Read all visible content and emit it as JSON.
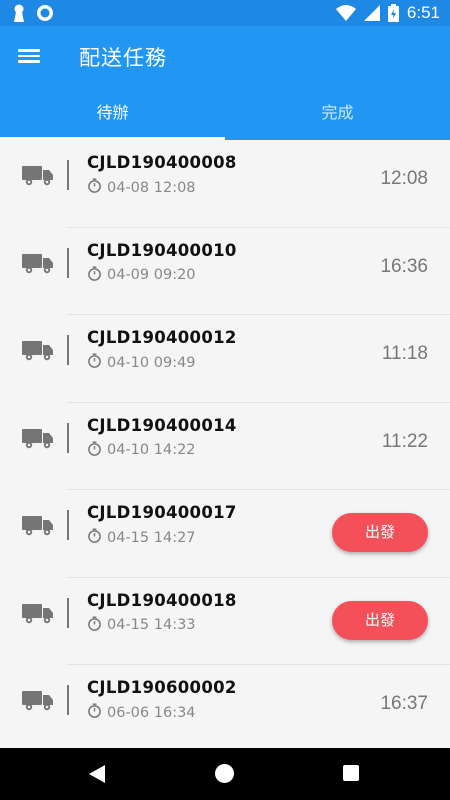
{
  "status_bar": {
    "time": "6:51",
    "icons": [
      "keyhole-icon",
      "circle-notification-icon",
      "wifi-icon",
      "cell-signal-icon",
      "battery-charging-icon"
    ]
  },
  "app_bar": {
    "title": "配送任務",
    "menu_icon": "hamburger-menu-icon"
  },
  "tabs": [
    {
      "label": "待辦",
      "active": true
    },
    {
      "label": "完成",
      "active": false
    }
  ],
  "tasks": [
    {
      "code": "CJLD190400008",
      "datetime": "04-08 12:08",
      "right_time": "12:08",
      "action": null
    },
    {
      "code": "CJLD190400010",
      "datetime": "04-09 09:20",
      "right_time": "16:36",
      "action": null
    },
    {
      "code": "CJLD190400012",
      "datetime": "04-10 09:49",
      "right_time": "11:18",
      "action": null
    },
    {
      "code": "CJLD190400014",
      "datetime": "04-10 14:22",
      "right_time": "11:22",
      "action": null
    },
    {
      "code": "CJLD190400017",
      "datetime": "04-15 14:27",
      "right_time": null,
      "action": "出發"
    },
    {
      "code": "CJLD190400018",
      "datetime": "04-15 14:33",
      "right_time": null,
      "action": "出發"
    },
    {
      "code": "CJLD190600002",
      "datetime": "06-06 16:34",
      "right_time": "16:37",
      "action": null
    }
  ],
  "colors": {
    "primary": "#2196f3",
    "status_bar": "#1e88e5",
    "action_button": "#f4505a"
  },
  "nav_bar": {
    "icons": [
      "back-triangle-icon",
      "home-circle-icon",
      "recents-square-icon"
    ]
  }
}
